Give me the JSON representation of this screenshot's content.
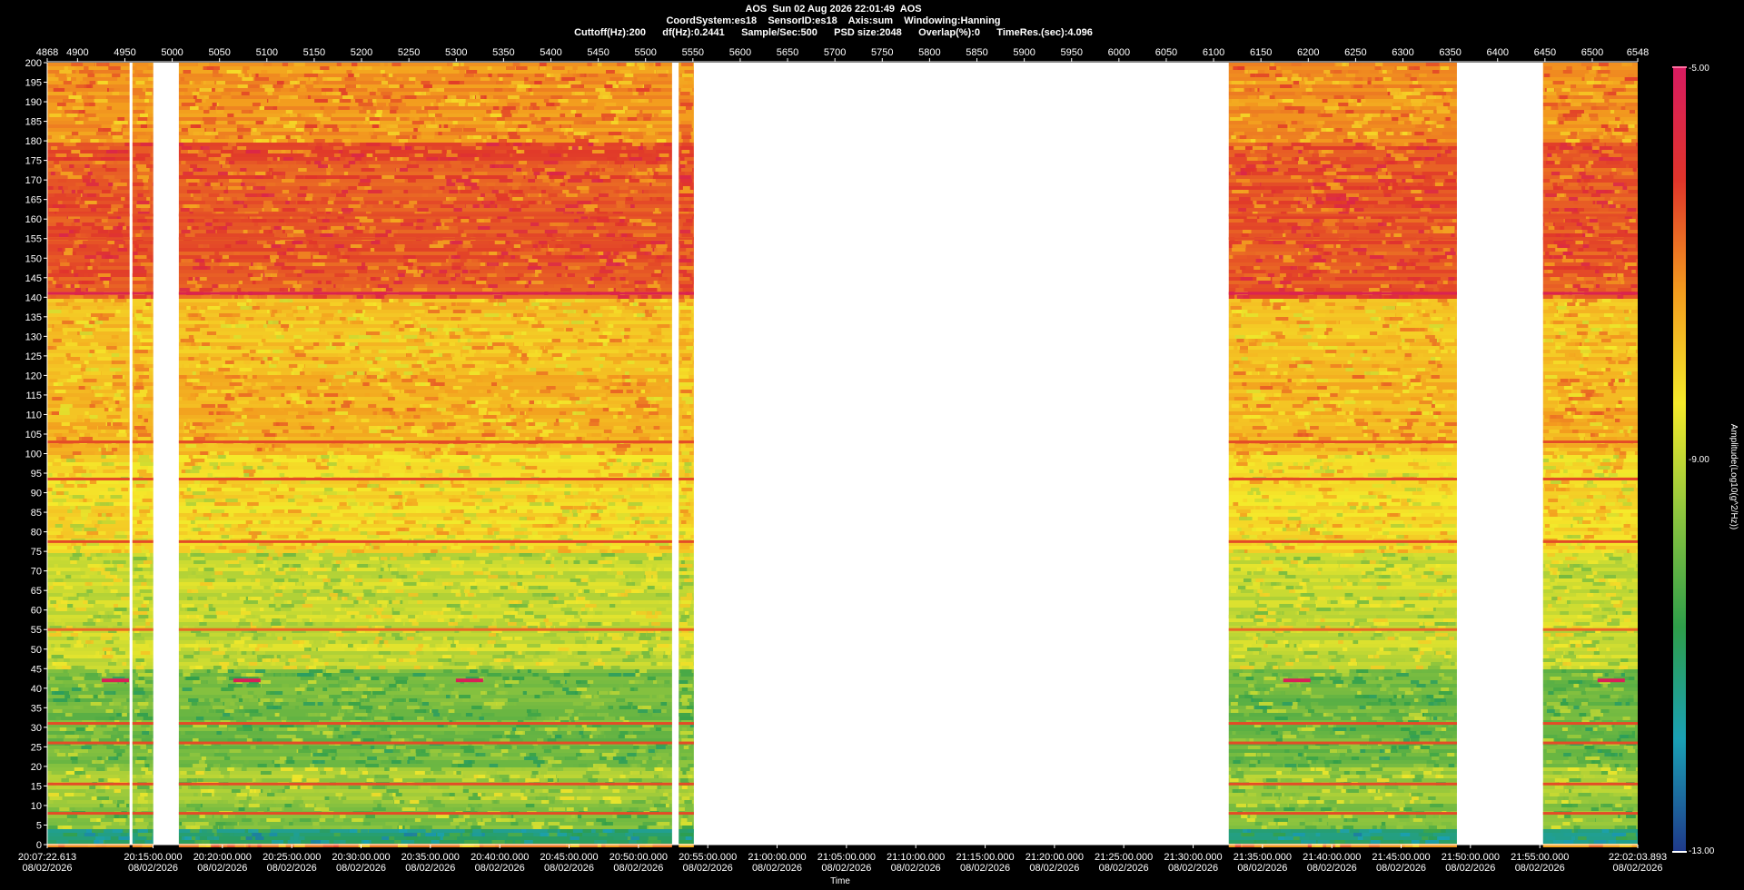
{
  "header": {
    "line1": "AOS  Sun 02 Aug 2026 22:01:49  AOS",
    "line2": "CoordSystem:es18    SensorID:es18    Axis:sum    Windowing:Hanning",
    "line3": "Cuttoff(Hz):200      df(Hz):0.2441      Sample/Sec:500      PSD size:2048      Overlap(%):0      TimeRes.(sec):4.096"
  },
  "chart_data": {
    "type": "heatmap",
    "title": "AOS  Sun 02 Aug 2026 22:01:49  AOS",
    "xlabel": "Time",
    "ylabel": "",
    "colorbar_label": "Amplitude(Log10(g^2/Hz))",
    "ylim": [
      0,
      200
    ],
    "y_ticks": [
      0,
      5,
      10,
      15,
      20,
      25,
      30,
      35,
      40,
      45,
      50,
      55,
      60,
      65,
      70,
      75,
      80,
      85,
      90,
      95,
      100,
      105,
      110,
      115,
      120,
      125,
      130,
      135,
      140,
      145,
      150,
      155,
      160,
      165,
      170,
      175,
      180,
      185,
      190,
      195,
      200
    ],
    "top_axis_range": [
      4868,
      6548
    ],
    "top_ticks": [
      "4868",
      "4900",
      "4950",
      "5000",
      "5050",
      "5100",
      "5150",
      "5200",
      "5250",
      "5300",
      "5350",
      "5400",
      "5450",
      "5500",
      "5550",
      "5600",
      "5650",
      "5700",
      "5750",
      "5800",
      "5850",
      "5900",
      "5950",
      "6000",
      "6050",
      "6100",
      "6150",
      "6200",
      "6250",
      "6300",
      "6350",
      "6400",
      "6450",
      "6500",
      "6548"
    ],
    "time_ticks": [
      {
        "time": "20:07:22.613",
        "date": "08/02/2026",
        "pos": 4868
      },
      {
        "time": "20:15:00.000",
        "date": "08/02/2026",
        "pos": 4979.8
      },
      {
        "time": "20:20:00.000",
        "date": "08/02/2026",
        "pos": 5053.0
      },
      {
        "time": "20:25:00.000",
        "date": "08/02/2026",
        "pos": 5126.3
      },
      {
        "time": "20:30:00.000",
        "date": "08/02/2026",
        "pos": 5199.5
      },
      {
        "time": "20:35:00.000",
        "date": "08/02/2026",
        "pos": 5272.7
      },
      {
        "time": "20:40:00.000",
        "date": "08/02/2026",
        "pos": 5346.0
      },
      {
        "time": "20:45:00.000",
        "date": "08/02/2026",
        "pos": 5419.2
      },
      {
        "time": "20:50:00.000",
        "date": "08/02/2026",
        "pos": 5492.5
      },
      {
        "time": "20:55:00.000",
        "date": "08/02/2026",
        "pos": 5565.7
      },
      {
        "time": "21:00:00.000",
        "date": "08/02/2026",
        "pos": 5638.9
      },
      {
        "time": "21:05:00.000",
        "date": "08/02/2026",
        "pos": 5712.2
      },
      {
        "time": "21:10:00.000",
        "date": "08/02/2026",
        "pos": 5785.4
      },
      {
        "time": "21:15:00.000",
        "date": "08/02/2026",
        "pos": 5858.7
      },
      {
        "time": "21:20:00.000",
        "date": "08/02/2026",
        "pos": 5931.9
      },
      {
        "time": "21:25:00.000",
        "date": "08/02/2026",
        "pos": 6005.1
      },
      {
        "time": "21:30:00.000",
        "date": "08/02/2026",
        "pos": 6078.4
      },
      {
        "time": "21:35:00.000",
        "date": "08/02/2026",
        "pos": 6151.6
      },
      {
        "time": "21:40:00.000",
        "date": "08/02/2026",
        "pos": 6224.9
      },
      {
        "time": "21:45:00.000",
        "date": "08/02/2026",
        "pos": 6298.1
      },
      {
        "time": "21:50:00.000",
        "date": "08/02/2026",
        "pos": 6371.3
      },
      {
        "time": "21:55:00.000",
        "date": "08/02/2026",
        "pos": 6444.6
      },
      {
        "time": "22:02:03.893",
        "date": "08/02/2026",
        "pos": 6548
      }
    ],
    "colorbar_range": [
      -13.0,
      -5.0
    ],
    "colorbar_ticks": [
      "-5.00",
      "-9.00",
      "-13.00"
    ],
    "colormap": [
      "#1f3a8a",
      "#1aa0b5",
      "#2e9e4a",
      "#8cc43e",
      "#f5ea2a",
      "#f39c1e",
      "#e0342a",
      "#d81b60"
    ],
    "data_gaps": [
      [
        4955,
        4958
      ],
      [
        4980,
        5007
      ],
      [
        5528,
        5535
      ],
      [
        5551,
        6116
      ],
      [
        6357,
        6448
      ]
    ],
    "spectral_features": {
      "band_levels": [
        {
          "from": 0,
          "to": 4,
          "level": -11.2
        },
        {
          "from": 4,
          "to": 10,
          "level": -9.6
        },
        {
          "from": 10,
          "to": 20,
          "level": -9.3
        },
        {
          "from": 20,
          "to": 45,
          "level": -9.9
        },
        {
          "from": 45,
          "to": 75,
          "level": -8.9
        },
        {
          "from": 75,
          "to": 100,
          "level": -8.2
        },
        {
          "from": 100,
          "to": 120,
          "level": -7.6
        },
        {
          "from": 120,
          "to": 140,
          "level": -7.8
        },
        {
          "from": 140,
          "to": 180,
          "level": -6.5
        },
        {
          "from": 180,
          "to": 200,
          "level": -7.2
        }
      ],
      "tonal_lines_hz": [
        8,
        15.5,
        26,
        31,
        55,
        77.5,
        93.5,
        103,
        141,
        155,
        161
      ],
      "intermittent_line_hz": 42
    }
  }
}
